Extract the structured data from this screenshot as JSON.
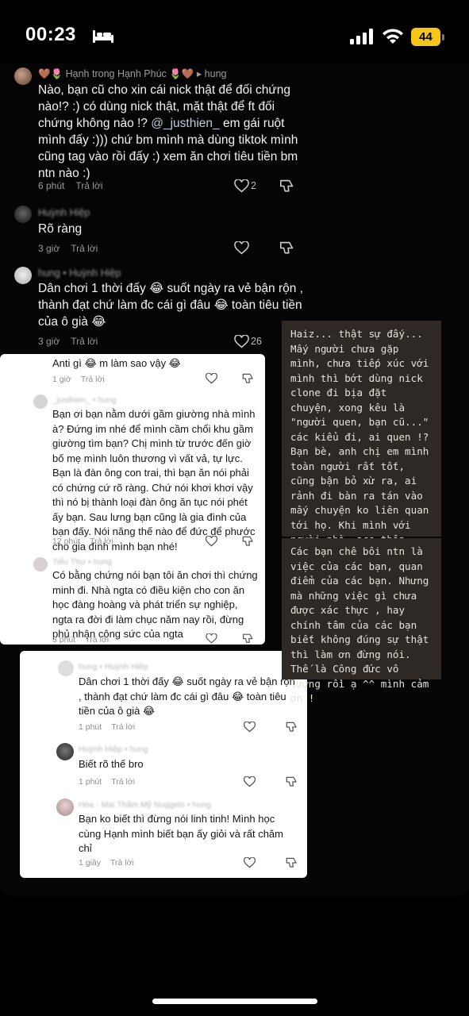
{
  "status": {
    "time": "00:23",
    "battery": "44"
  },
  "dark_comments": [
    {
      "name": "Hạnh trong Hạnh Phúc",
      "reply_to": "hung",
      "text_before": "Nào, bạn cũ cho xin cái nick thật để đối chứng nào!? :) có dùng nick thật, mặt thật để ft đối chứng không nào !? ",
      "mention": "@_justhien_",
      "text_after": " em gái ruột mình đấy :))) chứ bm mình mà dùng tiktok mình cũng tag vào rồi đấy :) xem ăn chơi tiêu tiền bm ntn nào :)",
      "time": "6 phút",
      "reply": "Trả lời",
      "likes": "2"
    },
    {
      "name": "Huỳnh Hiệp",
      "text": "Rõ ràng",
      "time": "3 giờ",
      "reply": "Trả lời"
    },
    {
      "name": "hung • Huỳnh Hiệp",
      "text": "Dân chơi 1 thời đấy 😂 suốt ngày ra vẻ bận rộn , thành đạt chứ làm đc cái gì đâu 😂 toàn tiêu tiền của ô già 😂",
      "time": "3 giờ",
      "reply": "Trả lời",
      "likes": "26"
    }
  ],
  "card1": {
    "top_comment": {
      "text": "Anti gì 😂 m làm sao vậy 😂",
      "time": "1 giờ",
      "reply": "Trả lời"
    },
    "comments": [
      {
        "name": "_justhien_ • hung",
        "text": "Bạn ơi bạn nằm dưới gầm giường nhà mình à? Đứng im nhé để mình cầm chổi khu gầm giường tìm bạn? Chị mình từ trước đến giờ bố mẹ mình luôn thương vì vất vả, tự lực. Bạn là đàn ông con trai, thì bạn ăn nói phải có chứng cứ rõ ràng. Chứ nói khơi khơi vậy thì nó bị thành loại đàn ông ăn tục nói phét ấy bạn. Sau lưng bạn cũng là gia đình của bạn đấy. Nói năng thế nào để đức để phước cho gia đình mình bạn nhé!",
        "time": "12 phút",
        "reply": "Trả lời"
      },
      {
        "name": "Tiểu Thư • hung",
        "text": "Có bằng chứng nói bạn tôi ăn chơi thì chứng minh đi. Nhà ngta có điều kiện cho con ăn học đàng hoàng và phát triển sự nghiệp, ngta ra đời đi làm chục năm nay rồi, đừng phủ nhận công sức của ngta",
        "time": "3 phút",
        "reply": "Trả lời"
      }
    ]
  },
  "card2": {
    "comments": [
      {
        "name": "hung • Huỳnh Hiệp",
        "text": "Dân chơi 1 thời đấy 😂 suốt ngày ra vẻ bận rộn , thành đạt chứ làm đc cái gì đâu 😂 toàn tiêu tiền của ô già 😂",
        "time": "1 phút",
        "reply": "Trả lời"
      },
      {
        "name": "Huỳnh Hiệp • hung",
        "text": "Biết rõ thế bro",
        "time": "1 phút",
        "reply": "Trả lời"
      },
      {
        "name": "Hòa - Mai Thẩm Mỹ Nuggets • hung",
        "text": "Bạn ko biết thì đừng nói linh tinh! Mình học cùng Hạnh mình biết bạn ấy giỏi và rất chăm chỉ",
        "time": "1 giây",
        "reply": "Trả lời"
      }
    ]
  },
  "notes": [
    "Haiz... thật sự đấy... Mấy người chưa gặp mình, chưa tiếp xúc với mình thì bớt dùng nick clone đi bịa đặt chuyện, xong kêu là \"người quen, bạn cũ...\" các kiểu đi, ai quen !? Bạn bè, anh chị em mình toàn người rất tốt, cũng bận bỏ xừ ra, ai rảnh đi bàn ra tán vào mấy chuyện ko liên quan tới họ. Khi mình với người nhà, ace thân thiết vô tình thấy vào cm thì lại xoá đi.",
    "Các bạn chê bôi ntn là việc của các bạn, quan điểm của các bạn. Nhưng mà những việc gì chưa được xác thực , hay chính tâm của các bạn biết không đúng sự thật thì làm ơn đừng nói. Thế là Công đức vô lượng rồi ạ ^^ mình cảm ơn !"
  ],
  "icons": [
    "bed-icon",
    "signal-icon",
    "wifi-icon",
    "heart-icon",
    "dislike-icon"
  ]
}
